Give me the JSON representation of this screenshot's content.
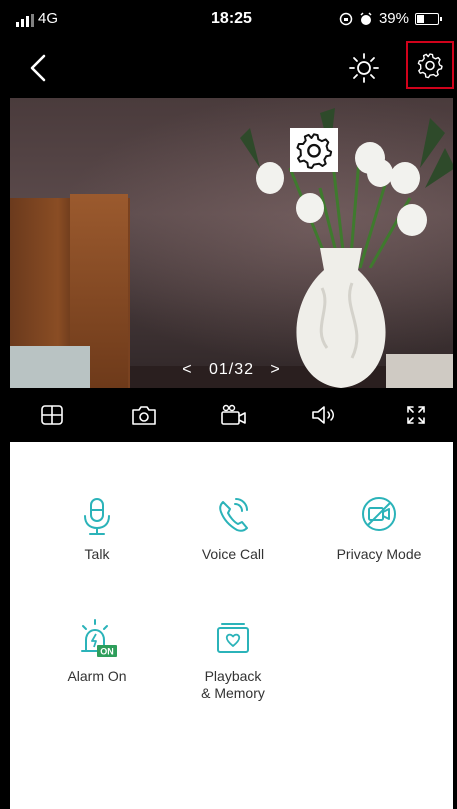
{
  "status_bar": {
    "network": "4G",
    "time": "18:25",
    "battery": "39%",
    "battery_level": 0.39
  },
  "nav": {
    "back_icon": "chevron-left-icon",
    "brightness_icon": "sun-icon",
    "settings_icon": "gear-icon"
  },
  "video": {
    "counter_prev": "<",
    "counter": "01/32",
    "counter_next": ">",
    "overlay_icon": "gear-icon"
  },
  "controls": [
    {
      "name": "layout-grid",
      "icon": "grid-icon"
    },
    {
      "name": "snapshot",
      "icon": "camera-icon"
    },
    {
      "name": "record",
      "icon": "video-camera-icon"
    },
    {
      "name": "sound",
      "icon": "speaker-icon"
    },
    {
      "name": "fullscreen",
      "icon": "fullscreen-icon"
    }
  ],
  "features": {
    "talk": "Talk",
    "voice_call": "Voice Call",
    "privacy_mode": "Privacy Mode",
    "alarm_on": "Alarm On",
    "alarm_badge": "ON",
    "playback": "Playback\n& Memory"
  },
  "colors": {
    "accent": "#2bb3b9",
    "highlight_box": "#d0021b",
    "badge_green": "#2e9e5b"
  }
}
